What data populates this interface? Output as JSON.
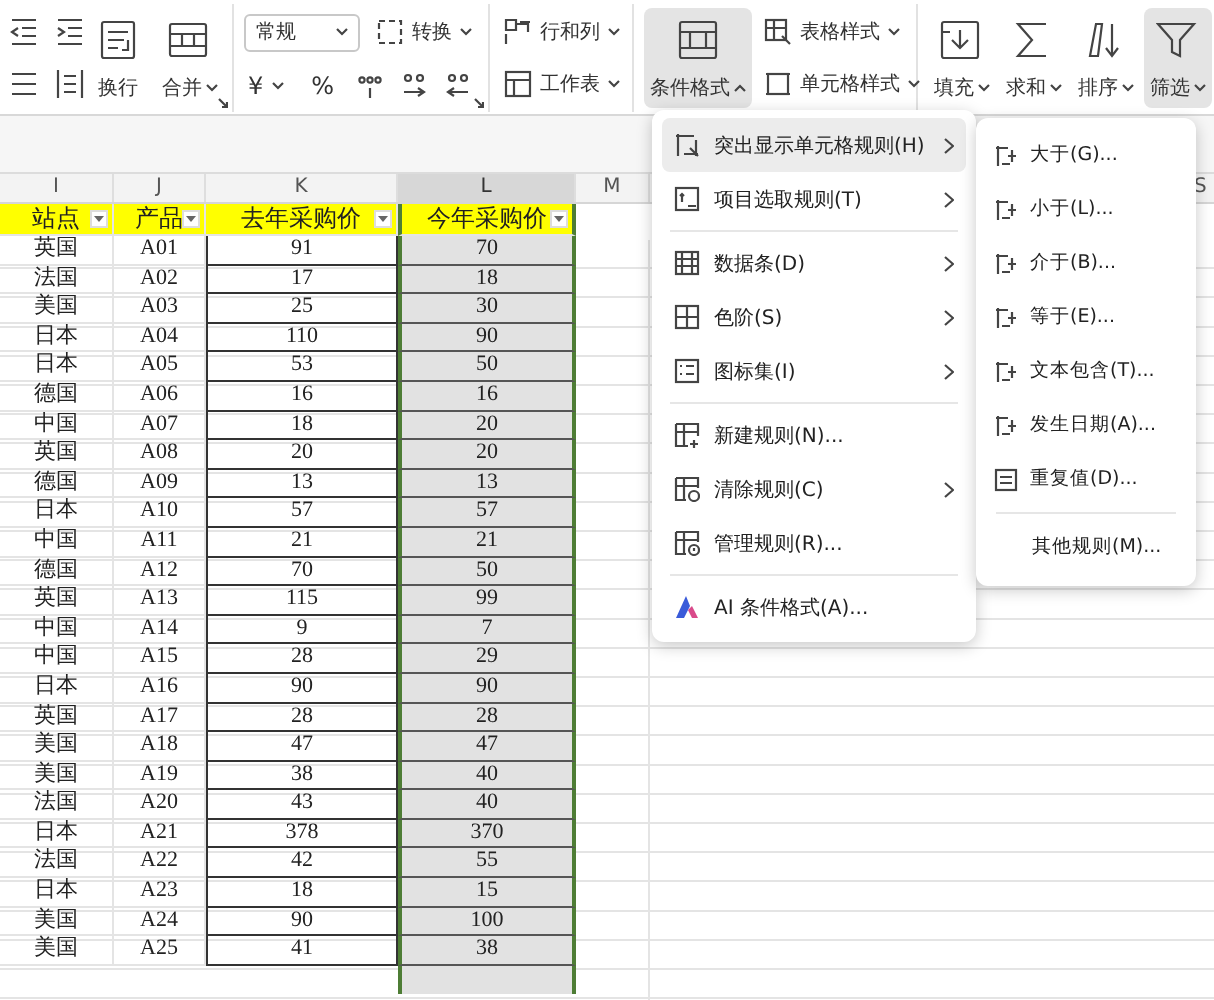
{
  "ribbon": {
    "wrap": "换行",
    "merge": "合并",
    "number_format": "常规",
    "convert": "转换",
    "currency": "¥",
    "percent": "%",
    "rows_cols": "行和列",
    "worksheet": "工作表",
    "conditional_format": {
      "label": "条件格式",
      "expanded": true,
      "selected": true
    },
    "table_style": "表格样式",
    "cell_style": "单元格样式",
    "edit_buttons": [
      {
        "label": "填充",
        "selected": false
      },
      {
        "label": "求和",
        "selected": false
      },
      {
        "label": "排序",
        "selected": false
      },
      {
        "label": "筛选",
        "selected": true
      }
    ]
  },
  "sheet": {
    "columns": [
      {
        "label": "I",
        "selected": false
      },
      {
        "label": "J",
        "selected": false
      },
      {
        "label": "K",
        "selected": false
      },
      {
        "label": "L",
        "selected": true
      },
      {
        "label": "M",
        "selected": false
      }
    ],
    "edge_column": "S",
    "header_row": [
      "站点",
      "产品",
      "去年采购价",
      "今年采购价"
    ],
    "rows": [
      [
        "英国",
        "A01",
        "91",
        "70"
      ],
      [
        "法国",
        "A02",
        "17",
        "18"
      ],
      [
        "美国",
        "A03",
        "25",
        "30"
      ],
      [
        "日本",
        "A04",
        "110",
        "90"
      ],
      [
        "日本",
        "A05",
        "53",
        "50"
      ],
      [
        "德国",
        "A06",
        "16",
        "16"
      ],
      [
        "中国",
        "A07",
        "18",
        "20"
      ],
      [
        "英国",
        "A08",
        "20",
        "20"
      ],
      [
        "德国",
        "A09",
        "13",
        "13"
      ],
      [
        "日本",
        "A10",
        "57",
        "57"
      ],
      [
        "中国",
        "A11",
        "21",
        "21"
      ],
      [
        "德国",
        "A12",
        "70",
        "50"
      ],
      [
        "英国",
        "A13",
        "115",
        "99"
      ],
      [
        "中国",
        "A14",
        "9",
        "7"
      ],
      [
        "中国",
        "A15",
        "28",
        "29"
      ],
      [
        "日本",
        "A16",
        "90",
        "90"
      ],
      [
        "英国",
        "A17",
        "28",
        "28"
      ],
      [
        "美国",
        "A18",
        "47",
        "47"
      ],
      [
        "美国",
        "A19",
        "38",
        "40"
      ],
      [
        "法国",
        "A20",
        "43",
        "40"
      ],
      [
        "日本",
        "A21",
        "378",
        "370"
      ],
      [
        "法国",
        "A22",
        "42",
        "55"
      ],
      [
        "日本",
        "A23",
        "18",
        "15"
      ],
      [
        "美国",
        "A24",
        "90",
        "100"
      ],
      [
        "美国",
        "A25",
        "41",
        "38"
      ]
    ]
  },
  "menu": {
    "sections": [
      [
        {
          "label": "突出显示单元格规则(H)",
          "has_submenu": true,
          "selected": true
        },
        {
          "label": "项目选取规则(T)",
          "has_submenu": true,
          "selected": false
        }
      ],
      [
        {
          "label": "数据条(D)",
          "has_submenu": true,
          "selected": false
        },
        {
          "label": "色阶(S)",
          "has_submenu": true,
          "selected": false
        },
        {
          "label": "图标集(I)",
          "has_submenu": true,
          "selected": false
        }
      ],
      [
        {
          "label": "新建规则(N)...",
          "has_submenu": false,
          "selected": false
        },
        {
          "label": "清除规则(C)",
          "has_submenu": true,
          "selected": false
        },
        {
          "label": "管理规则(R)...",
          "has_submenu": false,
          "selected": false
        }
      ],
      [
        {
          "label": "AI 条件格式(A)...",
          "has_submenu": false,
          "selected": false
        }
      ]
    ]
  },
  "submenu": {
    "items": [
      "大于(G)...",
      "小于(L)...",
      "介于(B)...",
      "等于(E)...",
      "文本包含(T)...",
      "发生日期(A)...",
      "重复值(D)..."
    ],
    "footer": "其他规则(M)..."
  }
}
